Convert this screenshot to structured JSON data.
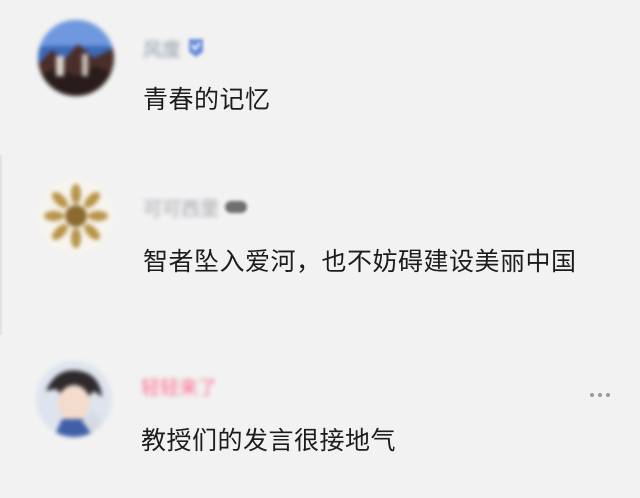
{
  "comments": [
    {
      "name": "风度",
      "text": "青春的记忆",
      "avatar_icon": "landscape-avatar",
      "badge_icon": "verified-badge-icon"
    },
    {
      "name": "可可西里",
      "text": "智者坠入爱河，也不妨碍建设美丽中国",
      "avatar_icon": "sunflower-avatar",
      "badge_icon": "level-badge-icon"
    },
    {
      "name": "轻轻来了",
      "text": "教授们的发言很接地气",
      "avatar_icon": "anime-character-avatar",
      "more_icon": "more-options-icon"
    }
  ],
  "colors": {
    "background": "#f2f2f2",
    "text": "#1c1c1c",
    "name_default": "#8d96a8",
    "name_highlight": "#ff6c8a"
  }
}
